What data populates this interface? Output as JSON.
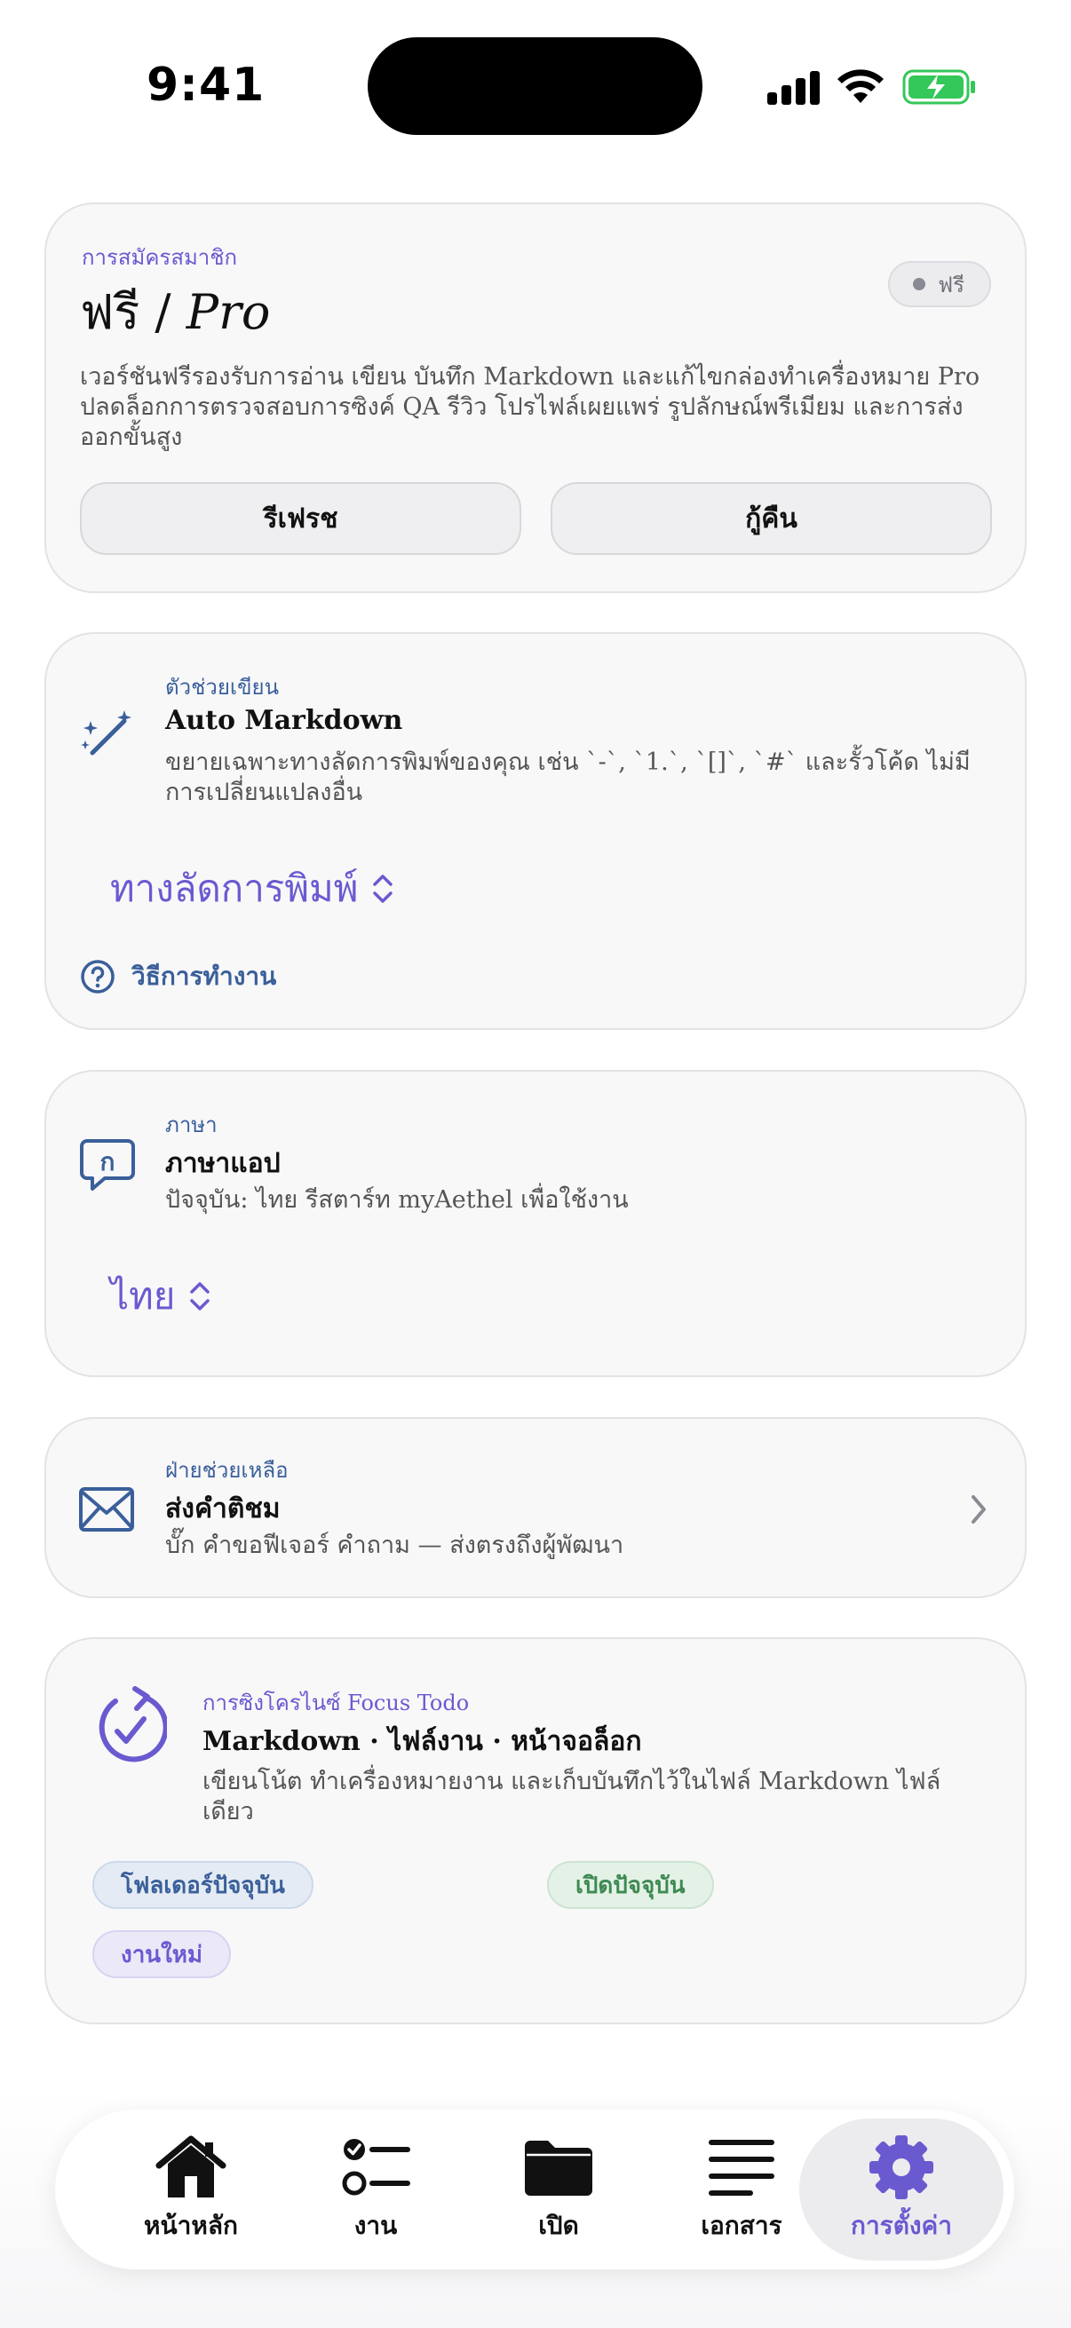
{
  "status_bar": {
    "time": "9:41"
  },
  "subscription": {
    "eyebrow": "การสมัครสมาชิก",
    "title_free": "ฟรี /",
    "title_pro": "Pro",
    "badge": "ฟรี",
    "description": "เวอร์ชันฟรีรองรับการอ่าน เขียน บันทึก Markdown และแก้ไขกล่องทำเครื่องหมาย Pro ปลดล็อกการตรวจสอบการซิงค์ QA รีวิว โปรไฟล์เผยแพร่ รูปลักษณ์พรีเมียม และการส่งออกขั้นสูง",
    "refresh_label": "รีเฟรช",
    "restore_label": "กู้คืน"
  },
  "markdown_helper": {
    "eyebrow": "ตัวช่วยเขียน",
    "title": "Auto Markdown",
    "description": "ขยายเฉพาะทางลัดการพิมพ์ของคุณ เช่น `-`, `1.`, `[]`, `#` และรั้วโค้ด ไม่มีการเปลี่ยนแปลงอื่น",
    "picker_value": "ทางลัดการพิมพ์",
    "how_it_works": "วิธีการทำงาน"
  },
  "language": {
    "eyebrow": "ภาษา",
    "title": "ภาษาแอป",
    "description": "ปัจจุบัน: ไทย รีสตาร์ท myAethel เพื่อใช้งาน",
    "picker_value": "ไทย"
  },
  "feedback": {
    "eyebrow": "ฝ่ายช่วยเหลือ",
    "title": "ส่งคำติชม",
    "description": "บั๊ก คำขอฟีเจอร์ คำถาม — ส่งตรงถึงผู้พัฒนา"
  },
  "sync": {
    "eyebrow": "การซิงโครไนซ์ Focus Todo",
    "title": "Markdown · ไฟล์งาน · หน้าจอล็อก",
    "description": "เขียนโน้ต ทำเครื่องหมายงาน และเก็บบันทึกไว้ในไฟล์ Markdown ไฟล์เดียว",
    "chips": [
      "โฟลเดอร์ปัจจุบัน",
      "เปิดปัจจุบัน",
      "งานใหม่"
    ]
  },
  "tabs": [
    {
      "label": "หน้าหลัก",
      "icon": "house-icon"
    },
    {
      "label": "งาน",
      "icon": "checklist-icon"
    },
    {
      "label": "เปิด",
      "icon": "folder-icon"
    },
    {
      "label": "เอกสาร",
      "icon": "document-lines-icon"
    },
    {
      "label": "การตั้งค่า",
      "icon": "gear-icon",
      "active": true
    }
  ],
  "colors": {
    "accent": "#6a5ad0",
    "secondary": "#3a5f9a",
    "battery": "#34c759"
  }
}
